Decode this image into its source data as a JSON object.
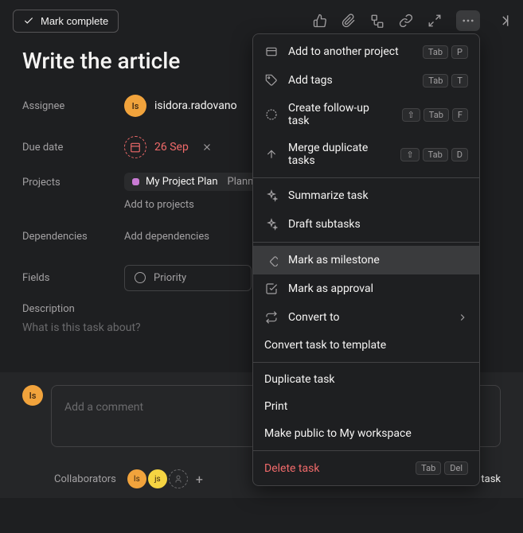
{
  "toolbar": {
    "mark_complete_label": "Mark complete"
  },
  "task": {
    "title": "Write the article",
    "assignee_label": "Assignee",
    "assignee_initials": "Is",
    "assignee_name": "isidora.radovano",
    "due_date_label": "Due date",
    "due_date_value": "26 Sep",
    "projects_label": "Projects",
    "project_name": "My Project Plan",
    "project_section": "Plann",
    "add_to_projects": "Add to projects",
    "dependencies_label": "Dependencies",
    "add_dependencies": "Add dependencies",
    "fields_label": "Fields",
    "priority_label": "Priority",
    "description_label": "Description",
    "description_placeholder": "What is this task about?"
  },
  "comment": {
    "avatar_initials": "Is",
    "placeholder": "Add a comment"
  },
  "footer": {
    "collaborators_label": "Collaborators",
    "avatar1": "Is",
    "avatar2": "js",
    "leave_task_label": "Leave task"
  },
  "menu": {
    "add_to_project": "Add to another project",
    "add_tags": "Add tags",
    "create_followup": "Create follow-up task",
    "merge_duplicate": "Merge duplicate tasks",
    "summarize": "Summarize task",
    "draft_subtasks": "Draft subtasks",
    "mark_milestone": "Mark as milestone",
    "mark_approval": "Mark as approval",
    "convert_to": "Convert to",
    "convert_template": "Convert task to template",
    "duplicate": "Duplicate task",
    "print": "Print",
    "make_public": "Make public to My workspace",
    "delete": "Delete task",
    "shortcuts": {
      "tab": "Tab",
      "p": "P",
      "t": "T",
      "f": "F",
      "d": "D",
      "del": "Del",
      "shift": "⇧"
    }
  }
}
